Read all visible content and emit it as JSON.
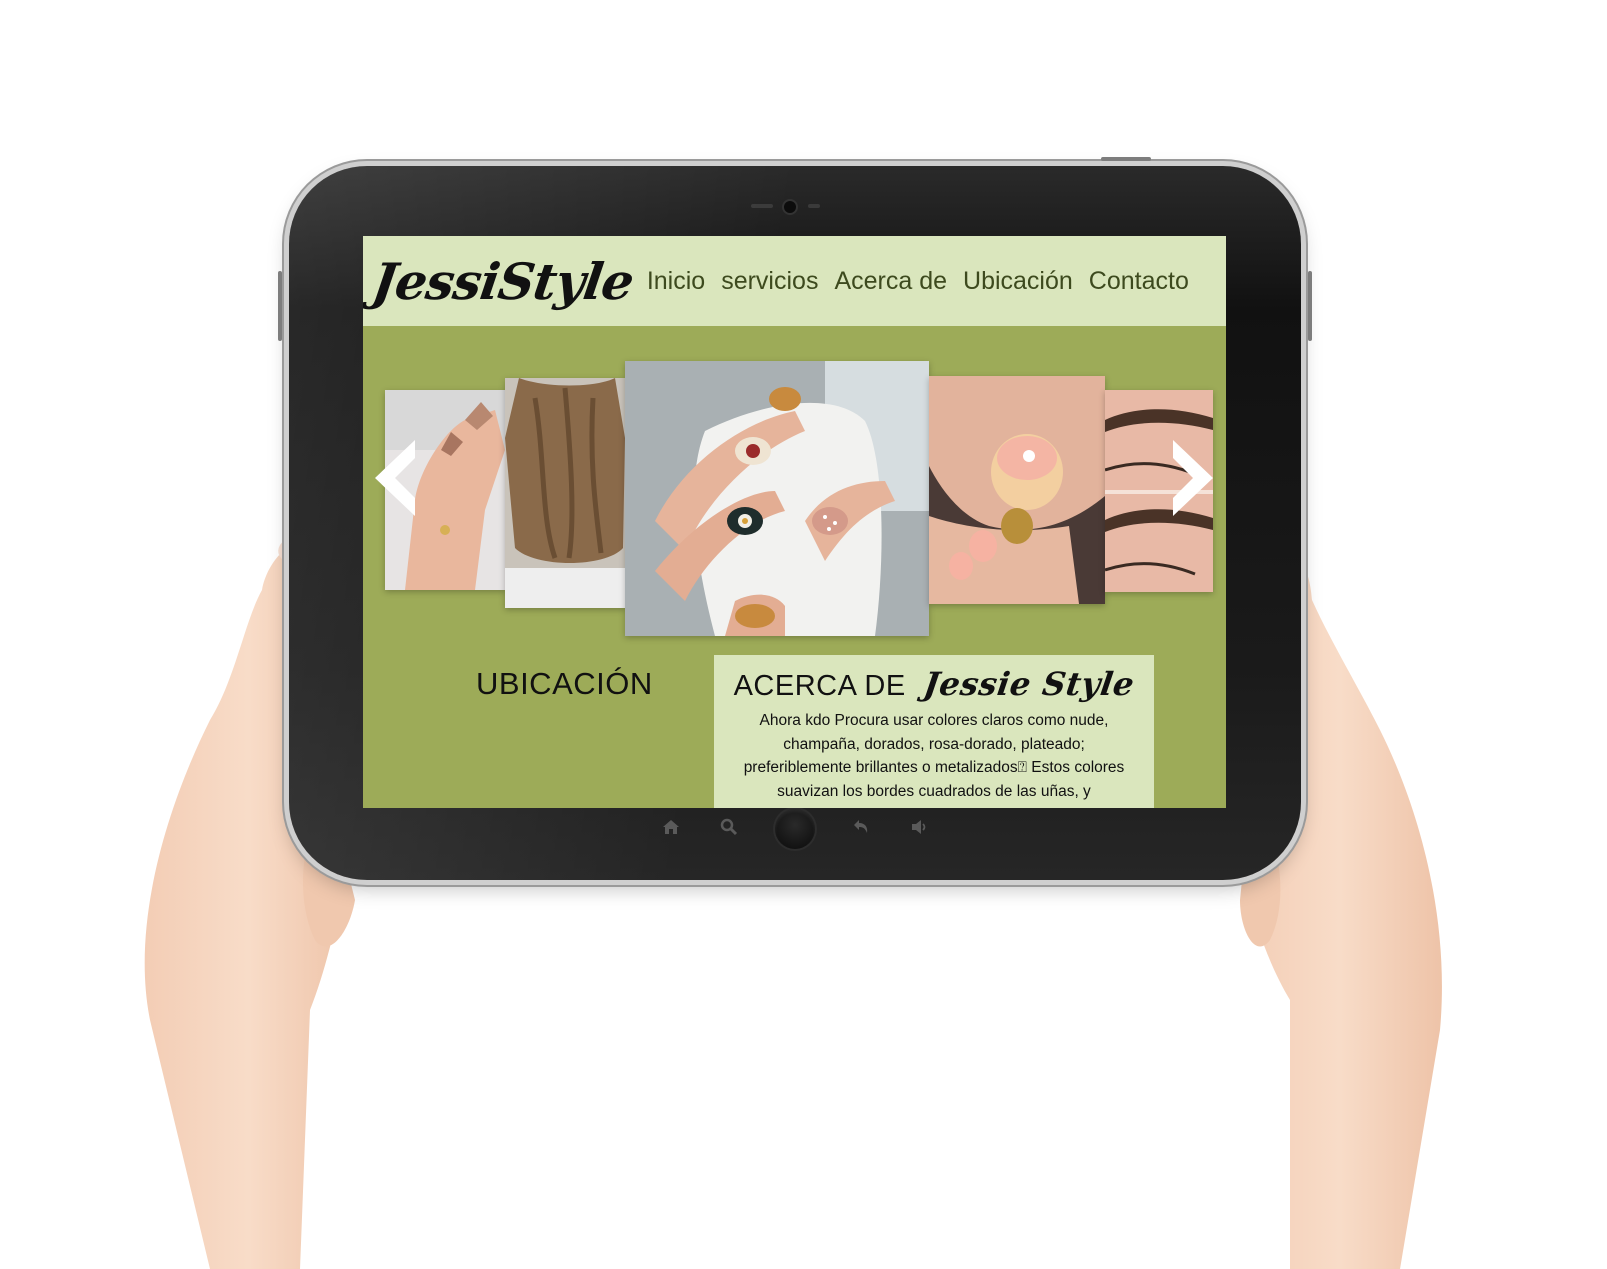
{
  "site": {
    "logo": "JessiStyle",
    "nav": {
      "inicio": "Inicio",
      "servicios": "servicios",
      "acerca": "Acerca de",
      "ubicacion": "Ubicación",
      "contacto": "Contacto"
    }
  },
  "carousel": {
    "prev_icon": "chevron-left-icon",
    "next_icon": "chevron-right-icon",
    "slides": [
      "hand-manicure-photo",
      "long-hair-photo",
      "floral-nail-art-photo",
      "pedicure-photo",
      "eyebrow-photo"
    ]
  },
  "sections": {
    "ubicacion_title": "UBICACIÓN",
    "about_heading": "ACERCA DE",
    "about_brand": "Jessie Style",
    "about_text": "Ahora kdo Procura usar colores claros como nude, champaña, dorados, rosa-dorado, plateado; preferiblemente brillantes o metalizados⍰ Estos colores suavizan los bordes cuadrados de las uñas, y"
  },
  "colors": {
    "header_bg": "#dae6bd",
    "page_bg": "#9dab58",
    "nav_text": "#3d4a1e",
    "tablet_body": "#111111"
  },
  "device": {
    "controls": [
      "home-icon",
      "search-icon",
      "home-button",
      "back-icon",
      "volume-icon"
    ]
  }
}
